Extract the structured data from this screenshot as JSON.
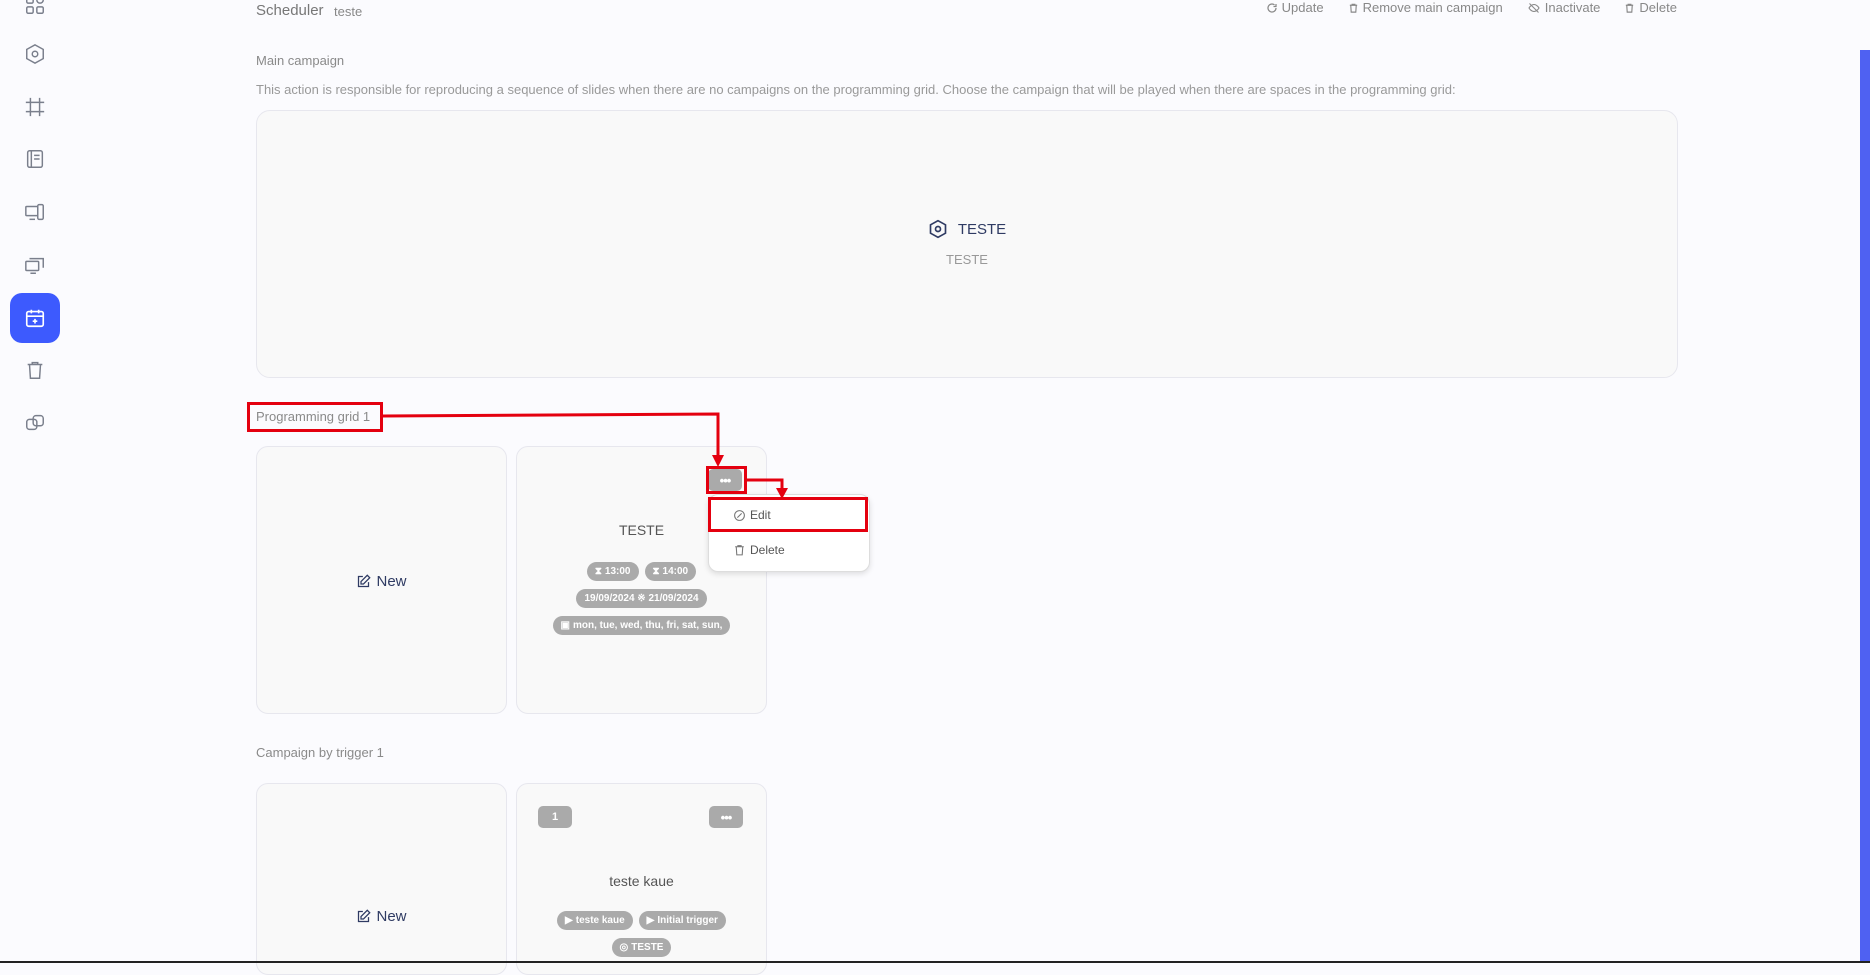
{
  "header": {
    "title": "Scheduler",
    "subtitle": "teste",
    "actions": [
      {
        "label": "Update",
        "icon": "refresh-icon"
      },
      {
        "label": "Remove main campaign",
        "icon": "trash-icon"
      },
      {
        "label": "Inactivate",
        "icon": "eye-off-icon"
      },
      {
        "label": "Delete",
        "icon": "trash-icon"
      }
    ]
  },
  "sidebar": {
    "items": [
      {
        "icon": "dashboard-icon",
        "active": false
      },
      {
        "icon": "campaign-icon",
        "active": false
      },
      {
        "icon": "grid-frame-icon",
        "active": false
      },
      {
        "icon": "book-icon",
        "active": false
      },
      {
        "icon": "devices-icon",
        "active": false
      },
      {
        "icon": "monitors-icon",
        "active": false
      },
      {
        "icon": "calendar-plus-icon",
        "active": true
      },
      {
        "icon": "trash-icon",
        "active": false
      },
      {
        "icon": "layers-icon",
        "active": false
      }
    ]
  },
  "main_campaign": {
    "label": "Main campaign",
    "description": "This action is responsible for reproducing a sequence of slides when there are no campaigns on the programming grid. Choose the campaign that will be played when there are spaces in the programming grid:",
    "name": "TESTE",
    "sub": "TESTE"
  },
  "programming_grid": {
    "label": "Programming grid 1",
    "new_label": "New",
    "card": {
      "title": "TESTE",
      "start_time": "13:00",
      "end_time": "14:00",
      "date_range": "19/09/2024 ※ 21/09/2024",
      "days": "mon, tue, wed, thu, fri, sat, sun,",
      "menu_button": "•••"
    },
    "menu": {
      "edit": "Edit",
      "delete": "Delete"
    }
  },
  "trigger": {
    "label": "Campaign by trigger 1",
    "new_label": "New",
    "card": {
      "badge": "1",
      "menu_button": "•••",
      "title": "teste kaue",
      "pill_a": "teste kaue",
      "pill_b": "Initial trigger",
      "pill_c": "TESTE"
    }
  },
  "colors": {
    "accent": "#3d5afe",
    "annotation": "#e4000f",
    "pill": "#aaaaaa"
  }
}
